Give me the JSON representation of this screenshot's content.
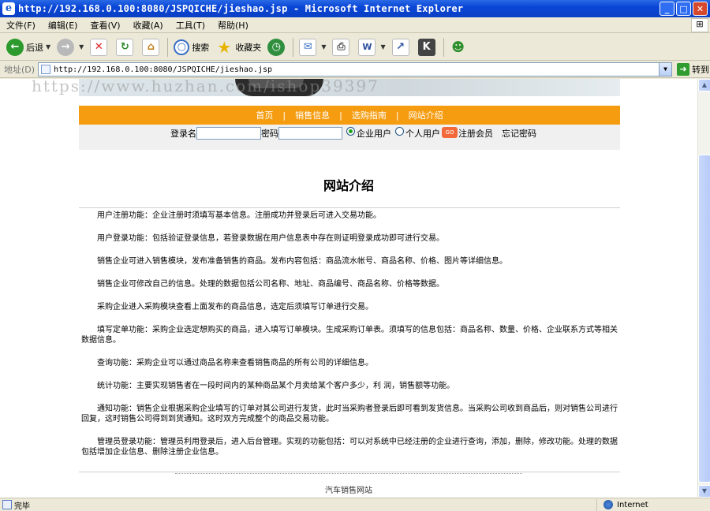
{
  "window": {
    "title": "http://192.168.0.100:8080/JSPQICHE/jieshao.jsp - Microsoft Internet Explorer",
    "ie_icon": "ie-logo",
    "buttons": [
      "minimize-icon",
      "maximize-icon",
      "close-icon"
    ]
  },
  "menu": {
    "items": [
      "文件(F)",
      "编辑(E)",
      "查看(V)",
      "收藏(A)",
      "工具(T)",
      "帮助(H)"
    ]
  },
  "toolbar": {
    "back_label": "后退",
    "search_label": "搜索",
    "favorites_label": "收藏夹"
  },
  "address": {
    "label": "地址(D)",
    "url": "http://192.168.0.100:8080/JSPQICHE/jieshao.jsp",
    "go_label": "转到"
  },
  "watermark": "https://www.huzhan.com/ishop39397",
  "nav": {
    "items": [
      "首页",
      "销售信息",
      "选购指南",
      "网站介绍"
    ]
  },
  "login": {
    "username_label": "登录名",
    "password_label": "密码",
    "enterprise_label": "企业用户",
    "personal_label": "个人用户",
    "go_label": "GO",
    "register_label": "注册会员",
    "forgot_label": "忘记密码"
  },
  "page": {
    "heading": "网站介绍",
    "paragraphs": [
      "用户注册功能：企业注册时须填写基本信息。注册成功并登录后可进入交易功能。",
      "用户登录功能：包括验证登录信息，若登录数据在用户信息表中存在则证明登录成功即可进行交易。",
      "销售企业可进入销售模块，发布准备销售的商品。发布内容包括：商品流水帐号、商品名称、价格、图片等详细信息。",
      "销售企业可修改自己的信息。处理的数据包括公司名称、地址、商品编号、商品名称、价格等数据。",
      "采购企业进入采购模块查看上面发布的商品信息，选定后须填写订单进行交易。",
      "填写定单功能：采购企业选定想购买的商品，进入填写订单模块。生成采购订单表。须填写的信息包括：商品名称、数量、价格、企业联系方式等相关数据信息。",
      "查询功能：采购企业可以通过商品名称来查看销售商品的所有公司的详细信息。",
      "统计功能：主要实现销售者在一段时间内的某种商品某个月卖给某个客户多少，利 润，销售额等功能。",
      "通知功能：销售企业根据采购企业填写的订单对其公司进行发货，此时当采购者登录后即可看到发货信息。当采购公司收到商品后，则对销售公司进行回复，这时销售公司得到到货通知。这时双方完成整个的商品交易功能。",
      "管理员登录功能：管理员利用登录后，进入后台管理。实现的功能包括：可以对系统中已经注册的企业进行查询，添加，删除，修改功能。处理的数据包括增加企业信息、删除注册企业信息。"
    ],
    "footer": "汽车销售网站"
  },
  "status": {
    "text": "完毕",
    "zone": "Internet"
  }
}
